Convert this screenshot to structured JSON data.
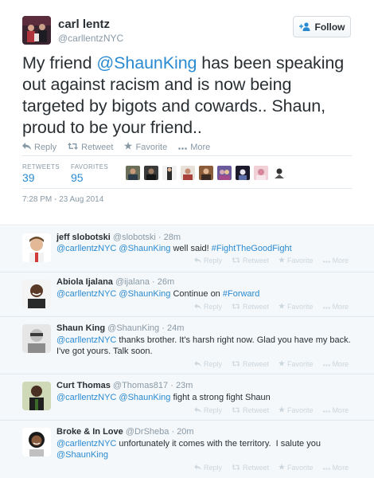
{
  "tweet": {
    "author_name": "carl lentz",
    "author_handle": "@carllentzNYC",
    "follow_label": "Follow",
    "text_before": "My friend ",
    "text_mention": "@ShaunKing",
    "text_after": " has been speaking out against racism and is now being targeted by bigots and cowards.. Shaun, proud to be your friend..",
    "actions": {
      "reply": "Reply",
      "retweet": "Retweet",
      "favorite": "Favorite",
      "more": "More"
    },
    "stats": {
      "retweets_label": "RETWEETS",
      "retweets_value": "39",
      "favorites_label": "FAVORITES",
      "favorites_value": "95"
    },
    "timestamp": "7:28 PM - 23 Aug 2014"
  },
  "replies": [
    {
      "name": "jeff slobotski",
      "handle": "@slobotski",
      "time": "28m",
      "parts": [
        {
          "t": "@carllentzNYC",
          "link": true
        },
        {
          "t": " ",
          "link": false
        },
        {
          "t": "@ShaunKing",
          "link": true
        },
        {
          "t": " well said! ",
          "link": false
        },
        {
          "t": "#FightTheGoodFight",
          "link": true
        }
      ]
    },
    {
      "name": "Abiola Ijalana",
      "handle": "@ijalana",
      "time": "26m",
      "parts": [
        {
          "t": "@carllentzNYC",
          "link": true
        },
        {
          "t": " ",
          "link": false
        },
        {
          "t": "@ShaunKing",
          "link": true
        },
        {
          "t": " Continue on ",
          "link": false
        },
        {
          "t": "#Forward",
          "link": true
        }
      ]
    },
    {
      "name": "Shaun King",
      "handle": "@ShaunKing",
      "time": "24m",
      "parts": [
        {
          "t": "@carllentzNYC",
          "link": true
        },
        {
          "t": " thanks brother. It's harsh right now. Glad you have my back. I've got yours. Talk soon.",
          "link": false
        }
      ]
    },
    {
      "name": "Curt Thomas",
      "handle": "@Thomas817",
      "time": "23m",
      "parts": [
        {
          "t": "@carllentzNYC",
          "link": true
        },
        {
          "t": " ",
          "link": false
        },
        {
          "t": "@ShaunKing",
          "link": true
        },
        {
          "t": " fight a strong fight Shaun",
          "link": false
        }
      ]
    },
    {
      "name": "Broke & In Love",
      "handle": "@DrSheba",
      "time": "20m",
      "parts": [
        {
          "t": "@carllentzNYC",
          "link": true
        },
        {
          "t": " unfortunately it comes with the territory.  I salute you ",
          "link": false
        },
        {
          "t": "@ShaunKing",
          "link": true
        }
      ]
    }
  ],
  "colors": {
    "link": "#2a8ad1",
    "muted": "#8899a6",
    "text": "#292f33",
    "reply_bg": "#f5f8fa"
  }
}
